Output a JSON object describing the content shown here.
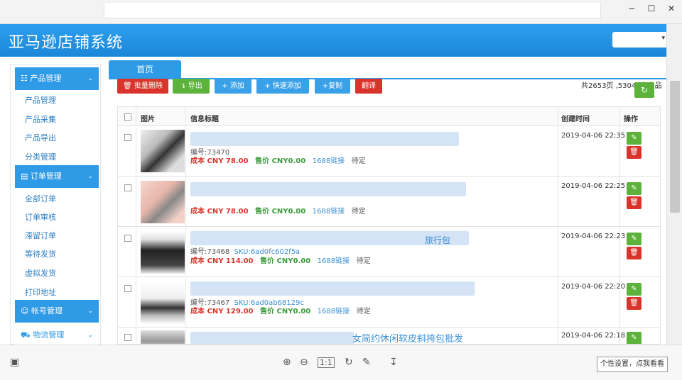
{
  "window": {
    "minimize": "−",
    "maximize": "☐",
    "close": "✕"
  },
  "app_title": "亚马逊店铺系统",
  "user_dropdown": {
    "caret": "▾"
  },
  "sidebar": {
    "groups": [
      {
        "label": "产品管理",
        "icon": "grid-icon",
        "items": [
          "产品管理",
          "产品采集",
          "产品导出",
          "分类管理"
        ]
      },
      {
        "label": "订单管理",
        "icon": "doc-icon",
        "items": [
          "全部订单",
          "订单审核",
          "滞留订单",
          "等待发货",
          "虚拟发货",
          "打印地址"
        ]
      },
      {
        "label": "帐号管理",
        "icon": "user-icon",
        "items": []
      },
      {
        "label": "物流管理",
        "icon": "truck-icon",
        "items": []
      }
    ]
  },
  "tab_home": "首页",
  "toolbar": {
    "batch_delete": "批量删除",
    "export": "导出",
    "add": "添加",
    "quick_add": "快速添加",
    "copy": "复制",
    "translate": "翻译"
  },
  "record_count": "共2653页 ,53042个产品",
  "table": {
    "headers": {
      "image": "图片",
      "title": "信息标题",
      "created": "创建时间",
      "actions": "操作"
    },
    "rows": [
      {
        "code": "编号:73470",
        "sku": "",
        "cost": "成本 CNY 78.00",
        "price": "售价 CNY0.00",
        "link": "1688链接",
        "status": "待定",
        "date": "2019-04-06 22:35"
      },
      {
        "code": "",
        "sku": "",
        "cost": "成本 CNY 78.00",
        "price": "售价 CNY0.00",
        "link": "1688链接",
        "status": "待定",
        "date": "2019-04-06 22:25"
      },
      {
        "code": "编号:73468",
        "sku": "SKU:6ad0fc602f5a",
        "cost": "成本 CNY 114.00",
        "price": "售价 CNY0.00",
        "link": "1688链接",
        "status": "待定",
        "date": "2019-04-06 22:23"
      },
      {
        "code": "编号:73467",
        "sku": "SKU:6ad0ab68129c",
        "cost": "成本 CNY 129.00",
        "price": "售价 CNY0.00",
        "link": "1688链接",
        "status": "待定",
        "date": "2019-04-06 22:20"
      },
      {
        "code": "",
        "sku": "",
        "cost": "",
        "price": "",
        "link": "",
        "status": "",
        "date": "2019-04-06 22:18",
        "title_tail": "女简约休闲软皮斜挎包批发"
      }
    ]
  },
  "row3_title_tail": "旅行包",
  "viewer": {
    "tooltip": "个性设置，点我看看"
  }
}
